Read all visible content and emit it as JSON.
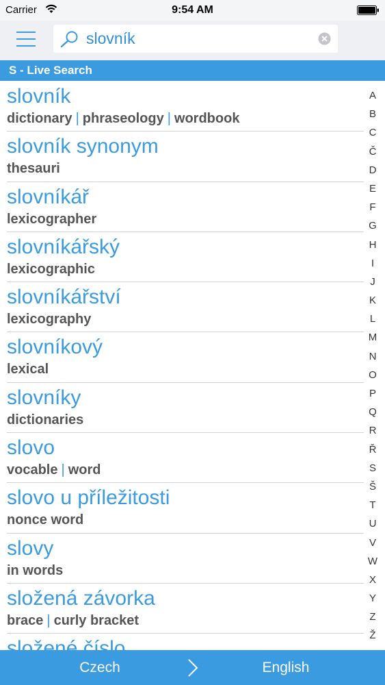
{
  "status_bar": {
    "carrier": "Carrier",
    "time": "9:54 AM"
  },
  "search": {
    "value": "slovník",
    "placeholder": ""
  },
  "section": {
    "title": "S - Live Search"
  },
  "results": [
    {
      "term": "slovník",
      "translations": [
        "dictionary",
        "phraseology",
        "wordbook"
      ]
    },
    {
      "term": "slovník synonym",
      "translations": [
        "thesauri"
      ]
    },
    {
      "term": "slovníkář",
      "translations": [
        "lexicographer"
      ]
    },
    {
      "term": "slovníkářský",
      "translations": [
        "lexicographic"
      ]
    },
    {
      "term": "slovníkářství",
      "translations": [
        "lexicography"
      ]
    },
    {
      "term": "slovníkový",
      "translations": [
        "lexical"
      ]
    },
    {
      "term": "slovníky",
      "translations": [
        "dictionaries"
      ]
    },
    {
      "term": "slovo",
      "translations": [
        "vocable",
        "word"
      ]
    },
    {
      "term": "slovo u příležitosti",
      "translations": [
        "nonce word"
      ]
    },
    {
      "term": "slovy",
      "translations": [
        "in words"
      ]
    },
    {
      "term": "složená závorka",
      "translations": [
        "brace",
        "curly bracket"
      ]
    },
    {
      "term": "složené číslo",
      "translations": []
    }
  ],
  "alphabet": [
    "A",
    "B",
    "C",
    "Č",
    "D",
    "E",
    "F",
    "G",
    "H",
    "I",
    "J",
    "K",
    "L",
    "M",
    "N",
    "O",
    "P",
    "Q",
    "R",
    "Ř",
    "S",
    "Š",
    "T",
    "U",
    "V",
    "W",
    "X",
    "Y",
    "Z",
    "Ž"
  ],
  "bottom_bar": {
    "from_language": "Czech",
    "to_language": "English"
  },
  "colors": {
    "accent": "#3a9be0",
    "translation_text": "#555555",
    "header_bg": "#eff0f3"
  },
  "icons": {
    "menu": "hamburger-menu-icon",
    "search": "magnifier-icon",
    "clear": "clear-x-circle-icon",
    "swap": "chevron-right-icon",
    "wifi": "wifi-icon",
    "battery": "battery-icon"
  }
}
